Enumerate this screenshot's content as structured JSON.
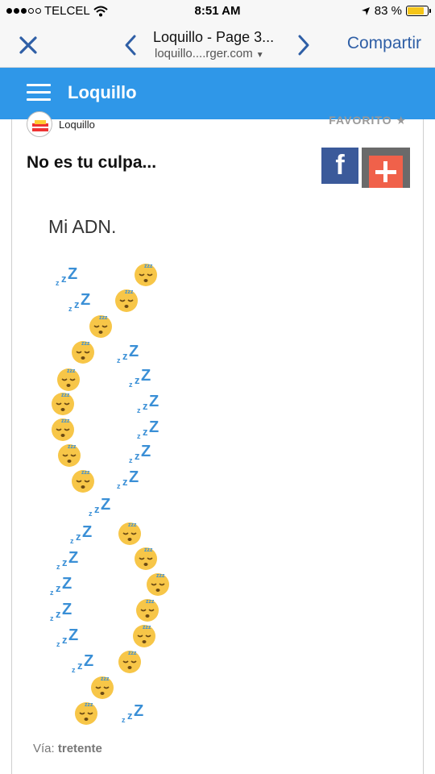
{
  "status_bar": {
    "carrier": "TELCEL",
    "time": "8:51 AM",
    "battery_percent": "83 %",
    "battery_level": 0.83,
    "battery_color": "#f5c518"
  },
  "browser": {
    "page_title": "Loquillo - Page 3...",
    "url": "loquillo....rger.com",
    "share_label": "Compartir",
    "accent": "#2f5fa6",
    "icons": [
      "close-icon",
      "back-chevron-icon",
      "forward-chevron-icon",
      "dropdown-caret-icon"
    ]
  },
  "blog": {
    "name": "Loquillo",
    "header_color": "#2f97e8"
  },
  "post": {
    "author": "Loquillo",
    "favorite_label": "FAVORITO",
    "title": "No es tu culpa...",
    "body_text": "Mi ADN.",
    "via_label": "Vía:",
    "via_source": "tretente",
    "share_buttons": [
      {
        "icon": "facebook-icon",
        "glyph": "f",
        "color": "#3b5a9a"
      },
      {
        "icon": "plus-share-icon",
        "color": "#f0614a"
      }
    ],
    "dna_image_icons": [
      "zzz-icon",
      "sleeping-face-emoji"
    ]
  }
}
